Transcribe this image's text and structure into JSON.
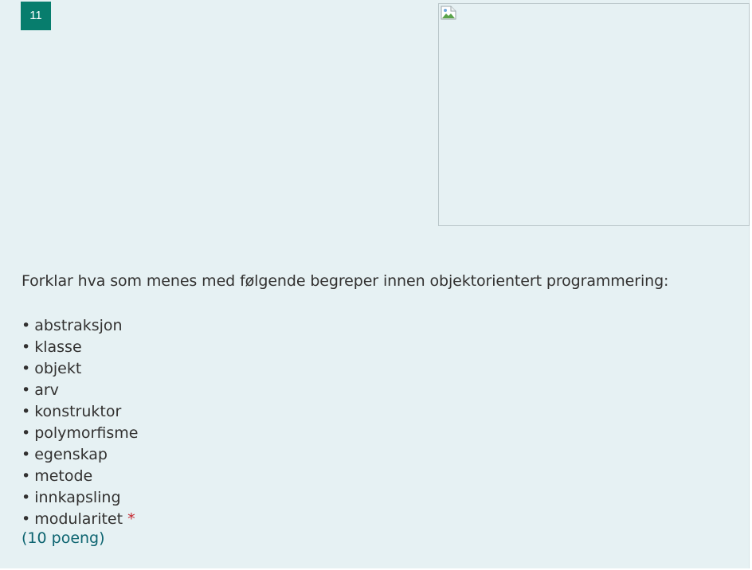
{
  "question": {
    "number": "11",
    "prompt": "Forklar hva som menes med følgende begreper innen objektorientert programmering:",
    "terms": [
      "abstraksjon",
      "klasse",
      "objekt",
      "arv",
      "konstruktor",
      "polymorfisme",
      "egenskap",
      "metode",
      "innkapsling",
      "modularitet"
    ],
    "bullet": "•",
    "required_marker": "*",
    "points": "(10 poeng)"
  },
  "colors": {
    "card_background": "#e6f1f3",
    "number_badge": "#077d6d",
    "required": "#c4262e",
    "points_text": "#0d6470"
  },
  "icons": {
    "image_placeholder": "broken-image-icon"
  }
}
